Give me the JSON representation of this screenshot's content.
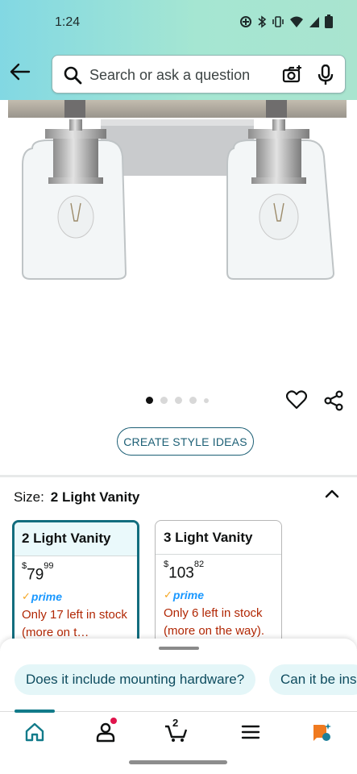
{
  "status_bar": {
    "time": "1:24"
  },
  "search": {
    "placeholder": "Search or ask a question"
  },
  "image_carousel": {
    "total_dots": 5,
    "active_index": 0
  },
  "style_button": {
    "label": "CREATE STYLE IDEAS"
  },
  "size_selector": {
    "label": "Size:",
    "selected": "2 Light Vanity",
    "options": [
      {
        "name": "2 Light Vanity",
        "price_symbol": "$",
        "price_whole": "79",
        "price_fraction": "99",
        "prime": "prime",
        "stock": "Only 17 left in stock (more on t…"
      },
      {
        "name": "3 Light Vanity",
        "price_symbol": "$",
        "price_whole": "103",
        "price_fraction": "82",
        "prime": "prime",
        "stock": "Only 6 left in stock (more on the way)."
      }
    ]
  },
  "suggestions": [
    "Does it include mounting hardware?",
    "Can it be ins"
  ],
  "nav": {
    "items": [
      "home-icon",
      "account-icon",
      "cart-icon",
      "menu-icon",
      "rufus-icon"
    ],
    "cart_count": "2"
  },
  "colors": {
    "accent": "#126d7e",
    "stock_red": "#b12704",
    "prime_blue": "#1a98ff",
    "header_start": "#82d8e3",
    "header_end": "#a9e4cf"
  }
}
